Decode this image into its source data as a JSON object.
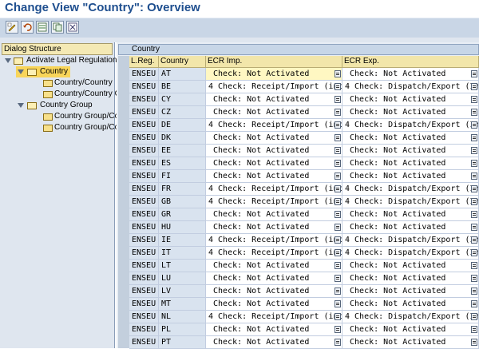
{
  "title": "Change View \"Country\": Overview",
  "toolbar": {
    "icons": [
      "edit-toggle-icon",
      "undo-icon",
      "new-entries-icon",
      "copy-icon",
      "delete-icon"
    ]
  },
  "dialog": {
    "header": "Dialog Structure",
    "items": [
      {
        "label": "Activate Legal Regulation",
        "level": 0
      },
      {
        "label": "Country",
        "level": 1
      },
      {
        "label": "Country/Country",
        "level": 2
      },
      {
        "label": "Country/Country C",
        "level": 2
      },
      {
        "label": "Country Group",
        "level": 1
      },
      {
        "label": "Country Group/Co",
        "level": 2
      },
      {
        "label": "Country Group/Co",
        "level": 2
      }
    ]
  },
  "table": {
    "caption": "Country",
    "columns": [
      "L.Reg.",
      "Country",
      "ECR Imp.",
      "ECR Exp."
    ],
    "rows": [
      {
        "lreg": "ENSEU",
        "country": "AT",
        "imp": " Check: Not Activated",
        "exp": " Check: Not Activated"
      },
      {
        "lreg": "ENSEU",
        "country": "BE",
        "imp": "4 Check: Receipt/Import (incl",
        "exp": "4 Check: Dispatch/Export (Inc"
      },
      {
        "lreg": "ENSEU",
        "country": "CY",
        "imp": " Check: Not Activated",
        "exp": " Check: Not Activated"
      },
      {
        "lreg": "ENSEU",
        "country": "CZ",
        "imp": " Check: Not Activated",
        "exp": " Check: Not Activated"
      },
      {
        "lreg": "ENSEU",
        "country": "DE",
        "imp": "4 Check: Receipt/Import (incl",
        "exp": "4 Check: Dispatch/Export (Inc"
      },
      {
        "lreg": "ENSEU",
        "country": "DK",
        "imp": " Check: Not Activated",
        "exp": " Check: Not Activated"
      },
      {
        "lreg": "ENSEU",
        "country": "EE",
        "imp": " Check: Not Activated",
        "exp": " Check: Not Activated"
      },
      {
        "lreg": "ENSEU",
        "country": "ES",
        "imp": " Check: Not Activated",
        "exp": " Check: Not Activated"
      },
      {
        "lreg": "ENSEU",
        "country": "FI",
        "imp": " Check: Not Activated",
        "exp": " Check: Not Activated"
      },
      {
        "lreg": "ENSEU",
        "country": "FR",
        "imp": "4 Check: Receipt/Import (incl",
        "exp": "4 Check: Dispatch/Export (Inc"
      },
      {
        "lreg": "ENSEU",
        "country": "GB",
        "imp": "4 Check: Receipt/Import (incl",
        "exp": "4 Check: Dispatch/Export (Inc"
      },
      {
        "lreg": "ENSEU",
        "country": "GR",
        "imp": " Check: Not Activated",
        "exp": " Check: Not Activated"
      },
      {
        "lreg": "ENSEU",
        "country": "HU",
        "imp": " Check: Not Activated",
        "exp": " Check: Not Activated"
      },
      {
        "lreg": "ENSEU",
        "country": "IE",
        "imp": "4 Check: Receipt/Import (incl",
        "exp": "4 Check: Dispatch/Export (Inc"
      },
      {
        "lreg": "ENSEU",
        "country": "IT",
        "imp": "4 Check: Receipt/Import (incl",
        "exp": "4 Check: Dispatch/Export (Inc"
      },
      {
        "lreg": "ENSEU",
        "country": "LT",
        "imp": " Check: Not Activated",
        "exp": " Check: Not Activated"
      },
      {
        "lreg": "ENSEU",
        "country": "LU",
        "imp": " Check: Not Activated",
        "exp": " Check: Not Activated"
      },
      {
        "lreg": "ENSEU",
        "country": "LV",
        "imp": " Check: Not Activated",
        "exp": " Check: Not Activated"
      },
      {
        "lreg": "ENSEU",
        "country": "MT",
        "imp": " Check: Not Activated",
        "exp": " Check: Not Activated"
      },
      {
        "lreg": "ENSEU",
        "country": "NL",
        "imp": "4 Check: Receipt/Import (incl",
        "exp": "4 Check: Dispatch/Export (Inc"
      },
      {
        "lreg": "ENSEU",
        "country": "PL",
        "imp": " Check: Not Activated",
        "exp": " Check: Not Activated"
      },
      {
        "lreg": "ENSEU",
        "country": "PT",
        "imp": " Check: Not Activated",
        "exp": " Check: Not Activated"
      }
    ]
  }
}
